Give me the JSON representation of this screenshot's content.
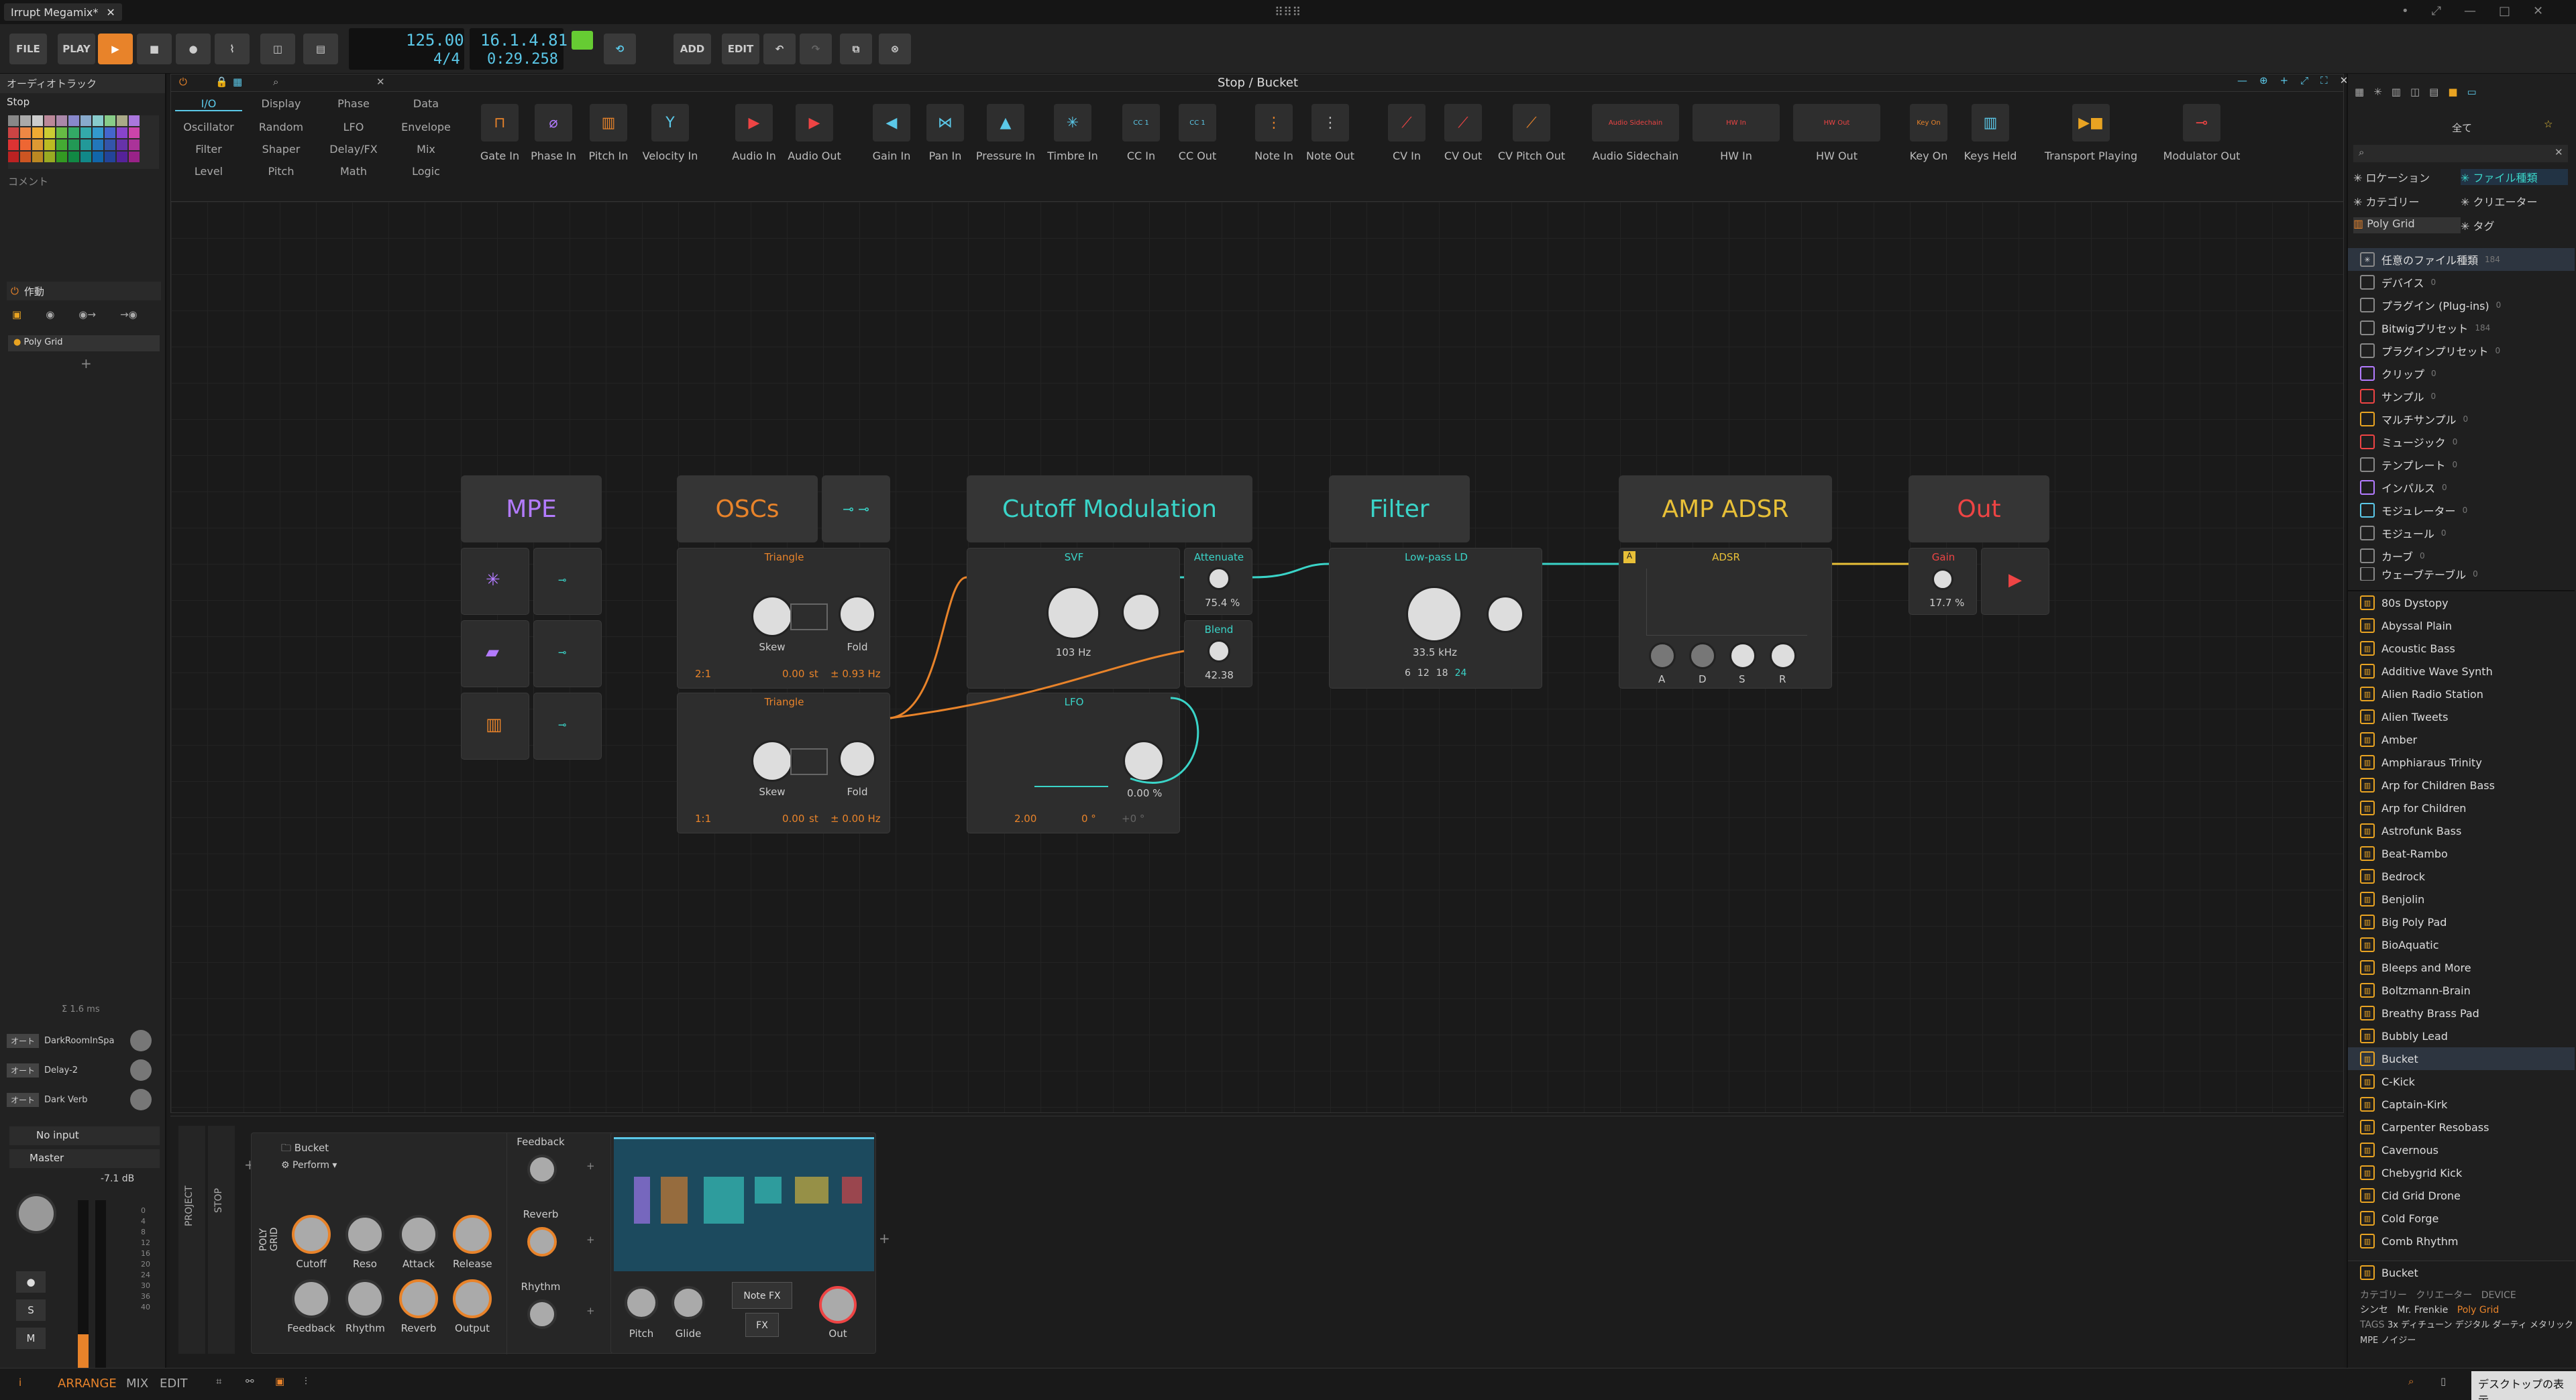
{
  "window": {
    "tab_title": "Irrupt Megamix*"
  },
  "toolbar": {
    "file": "FILE",
    "play": "PLAY",
    "tempo": "125.00",
    "time_sig": "4/4",
    "position": "16.1.4.81",
    "time": "0:29.258",
    "add": "ADD",
    "edit": "EDIT"
  },
  "left": {
    "track_header": "オーディオトラック",
    "launch_state": "Stop",
    "comment": "コメント",
    "fx_header": "作動",
    "device_chain_item": "Poly Grid",
    "latency": "Σ 1.6 ms",
    "sends": [
      {
        "mode": "オート",
        "name": "DarkRoomInSpa"
      },
      {
        "mode": "オート",
        "name": "Delay-2"
      },
      {
        "mode": "オート",
        "name": "Dark Verb"
      }
    ],
    "input": "No input",
    "output": "Master",
    "volume_db": "-7.1 dB",
    "btn_s": "S",
    "btn_m": "M",
    "meter_ticks": [
      "0",
      "4",
      "8",
      "12",
      "16",
      "20",
      "24",
      "30",
      "36",
      "40"
    ]
  },
  "editor": {
    "title": "Stop / Bucket",
    "categories": [
      [
        "I/O",
        "Display",
        "Phase",
        "Data"
      ],
      [
        "Oscillator",
        "Random",
        "LFO",
        "Envelope"
      ],
      [
        "Filter",
        "Shaper",
        "Delay/FX",
        "Mix"
      ],
      [
        "Level",
        "Pitch",
        "Math",
        "Logic"
      ]
    ],
    "palette": [
      "Gate In",
      "Phase In",
      "Pitch In",
      "Velocity In",
      "Audio In",
      "Audio Out",
      "Gain In",
      "Pan In",
      "Pressure In",
      "Timbre In",
      "CC In",
      "CC Out",
      "Note In",
      "Note Out",
      "CV In",
      "CV Out",
      "CV Pitch Out",
      "Audio Sidechain",
      "HW In",
      "HW Out",
      "Key On",
      "Keys Held",
      "Transport Playing",
      "Modulator Out"
    ]
  },
  "modules": {
    "groups": [
      "MPE",
      "OSCs",
      "Cutoff Modulation",
      "Filter",
      "AMP ADSR",
      "Out"
    ],
    "osc1": {
      "name": "Triangle",
      "skew": "Skew",
      "fold": "Fold",
      "ratio": "2:1",
      "st": "0.00",
      "st_unit": "st",
      "hz": "± 0.93 Hz"
    },
    "osc2": {
      "name": "Triangle",
      "skew": "Skew",
      "fold": "Fold",
      "ratio": "1:1",
      "st": "0.00",
      "st_unit": "st",
      "hz": "± 0.00 Hz"
    },
    "svf": {
      "name": "SVF",
      "freq": "103 Hz"
    },
    "attenuate": {
      "name": "Attenuate",
      "value": "75.4 %"
    },
    "blend": {
      "name": "Blend",
      "value": "42.38"
    },
    "lfo": {
      "name": "LFO",
      "value": "0.00 %",
      "rate": "2.00",
      "phase": "0 °",
      "offset": "+0 °"
    },
    "lowpass": {
      "name": "Low-pass LD",
      "freq": "33.5 kHz",
      "slopes": [
        "6",
        "12",
        "18",
        "24"
      ]
    },
    "adsr": {
      "name": "ADSR",
      "labels": [
        "A",
        "D",
        "S",
        "R"
      ]
    },
    "gain": {
      "name": "Gain",
      "value": "17.7 %"
    }
  },
  "browser": {
    "all_label": "全て",
    "filters": [
      "ロケーション",
      "ファイル種類",
      "カテゴリー",
      "クリエーター",
      "Poly Grid",
      "タグ"
    ],
    "types": [
      [
        "任意のファイル種類",
        "184"
      ],
      [
        "デバイス",
        "0"
      ],
      [
        "プラグイン (Plug-ins)",
        "0"
      ],
      [
        "Bitwigプリセット",
        "184"
      ],
      [
        "プラグインプリセット",
        "0"
      ],
      [
        "クリップ",
        "0"
      ],
      [
        "サンプル",
        "0"
      ],
      [
        "マルチサンプル",
        "0"
      ],
      [
        "ミュージック",
        "0"
      ],
      [
        "テンプレート",
        "0"
      ],
      [
        "インパルス",
        "0"
      ],
      [
        "モジュレーター",
        "0"
      ],
      [
        "モジュール",
        "0"
      ],
      [
        "カーブ",
        "0"
      ],
      [
        "ウェーブテーブル",
        "0"
      ]
    ],
    "presets": [
      "80s Dystopy",
      "Abyssal Plain",
      "Acoustic Bass",
      "Additive Wave Synth",
      "Alien Radio Station",
      "Alien Tweets",
      "Amber",
      "Amphiaraus Trinity",
      "Arp for Children Bass",
      "Arp for Children",
      "Astrofunk Bass",
      "Beat-Rambo",
      "Bedrock",
      "Benjolin",
      "Big Poly Pad",
      "BioAquatic",
      "Bleeps and More",
      "Boltzmann-Brain",
      "Breathy Brass Pad",
      "Bubbly Lead",
      "Bucket",
      "C-Kick",
      "Captain-Kirk",
      "Carpenter Resobass",
      "Cavernous",
      "Chebygrid Kick",
      "Cid Grid Drone",
      "Cold Forge",
      "Comb Rhythm"
    ],
    "selected": "Bucket",
    "info": {
      "name": "Bucket",
      "cat_label": "カテゴリー",
      "cat": "シンセ",
      "creator_label": "クリエーター",
      "creator": "Mr. Frenkie",
      "device_label": "DEVICE",
      "device": "Poly Grid",
      "tags_label": "TAGS",
      "tags": "3x ディチューン デジタル ダーティ メタリック MPE ノイジー"
    },
    "tooltip": "デスクトップの表示"
  },
  "device": {
    "project": "PROJECT",
    "stop": "STOP",
    "poly_grid": "POLY GRID",
    "preset": "Bucket",
    "mode": "Perform",
    "knobs": [
      "Cutoff",
      "Reso",
      "Attack",
      "Release",
      "Feedback",
      "Rhythm",
      "Reverb",
      "Output"
    ],
    "remote": [
      "Feedback",
      "Reverb",
      "Rhythm"
    ],
    "pitch": "Pitch",
    "glide": "Glide",
    "notefx": "Note FX",
    "fx": "FX",
    "out": "Out"
  },
  "status": {
    "arrange": "ARRANGE",
    "mix": "MIX",
    "edit": "EDIT"
  }
}
